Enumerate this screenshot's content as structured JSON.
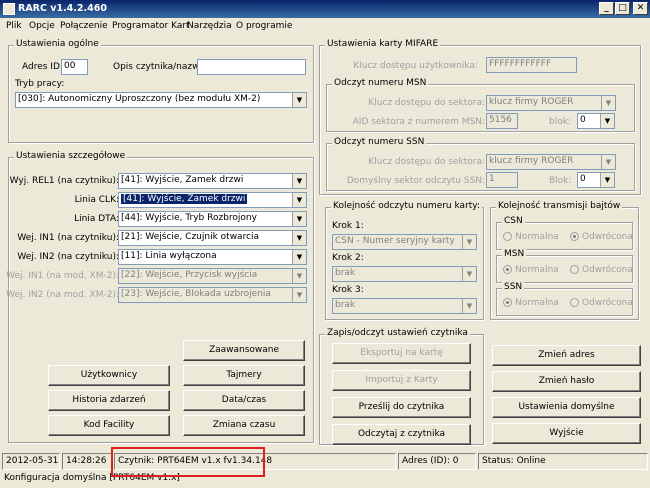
{
  "window": {
    "title": "RARC v1.4.2.460",
    "minimize": "_",
    "maximize": "□",
    "close": "✕"
  },
  "menu": [
    "Plik",
    "Opcje",
    "Połączenie",
    "Programator Kart",
    "Narzędzia",
    "O programie"
  ],
  "general": {
    "title": "Ustawienia ogólne",
    "address_label": "Adres ID:",
    "address_value": "00",
    "desc_label": "Opis czytnika/nazwa:",
    "desc_value": "",
    "mode_label": "Tryb pracy:",
    "mode_value": "[030]: Autonomiczny Uproszczony (bez modułu XM-2)"
  },
  "details": {
    "title": "Ustawienia szczegółowe",
    "rows": [
      {
        "label": "Wyj. REL1 (na czytniku):",
        "value": "[41]: Wyjście, Zamek drzwi"
      },
      {
        "label": "Linia CLK:",
        "value": "[41]: Wyjście, Zamek drzwi"
      },
      {
        "label": "Linia DTA:",
        "value": "[44]: Wyjście, Tryb Rozbrojony"
      },
      {
        "label": "Wej. IN1 (na czytniku):",
        "value": "[21]: Wejście, Czujnik otwarcia"
      },
      {
        "label": "Wej. IN2 (na czytniku):",
        "value": "[11]: Linia wyłączona"
      },
      {
        "label": "Wej. IN1 (na mod. XM-2):",
        "value": "[22]: Wejście, Przycisk wyjścia"
      },
      {
        "label": "Wej. IN2 (na mod. XM-2):",
        "value": "[23]: Wejście, Blokada uzbrojenia"
      }
    ]
  },
  "buttons_left": {
    "advanced": "Zaawansowane",
    "users": "Użytkownicy",
    "timers": "Tajmery",
    "history": "Historia zdarzeń",
    "datetime": "Data/czas",
    "facility": "Kod Facility",
    "timechange": "Zmiana czasu"
  },
  "mifare": {
    "title": "Ustawienia karty MIFARE",
    "user_key_label": "Klucz dostępu użytkownika:",
    "user_key_value": "FFFFFFFFFFFF",
    "msn": {
      "title": "Odczyt numeru MSN",
      "key_label": "Klucz dostępu do sektora:",
      "key_value": "klucz firmy ROGER",
      "aid_label": "AID sektora z numerem MSN:",
      "aid_value": "5156",
      "block_label": "blok:",
      "block_value": "0"
    },
    "ssn": {
      "title": "Odczyt numeru SSN",
      "key_label": "Klucz dostępu do sektora:",
      "key_value": "klucz firmy ROGER",
      "sector_label": "Domyślny sektor odczytu SSN:",
      "sector_value": "1",
      "block_label": "Blok:",
      "block_value": "0"
    }
  },
  "order": {
    "title": "Kolejność odczytu numeru karty:",
    "step1_label": "Krok 1:",
    "step1_value": "CSN - Numer seryjny karty",
    "step2_label": "Krok 2:",
    "step2_value": "brak",
    "step3_label": "Krok 3:",
    "step3_value": "brak"
  },
  "bytes": {
    "title": "Kolejność transmisji bajtów",
    "normal": "Normalna",
    "reversed": "Odwrócona",
    "groups": [
      {
        "title": "CSN",
        "selected": "Odwrócona"
      },
      {
        "title": "MSN",
        "selected": "Normalna"
      },
      {
        "title": "SSN",
        "selected": "Normalna"
      }
    ]
  },
  "rw": {
    "title": "Zapis/odczyt ustawień czytnika",
    "export": "Eksportuj na kartę",
    "import": "Importuj z Karty",
    "send": "Prześlij do czytnika",
    "read": "Odczytaj z czytnika"
  },
  "buttons_right": {
    "change_addr": "Zmień adres",
    "change_pass": "Zmień hasło",
    "defaults": "Ustawienia domyślne",
    "exit": "Wyjście"
  },
  "status": {
    "date": "2012-05-31",
    "time": "14:28:26",
    "reader": "Czytnik: PRT64EM v1.x fv1.34.148",
    "address": "Adres (ID): 0",
    "status": "Status: Online",
    "config": "Konfiguracja domyślna [PRT64EM v1.x]"
  },
  "colors": {
    "titlebar": "#0a246a",
    "highlight": "#e02020",
    "selection": "#0a246a"
  }
}
